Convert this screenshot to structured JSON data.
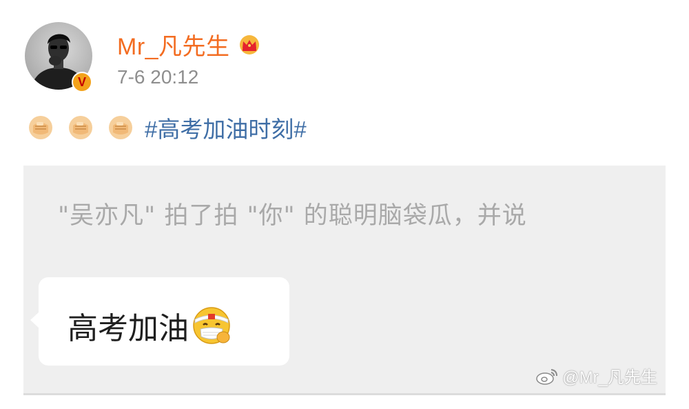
{
  "post": {
    "author": {
      "name": "Mr_凡先生",
      "avatar_icon": "user-avatar-icon",
      "badge_icon": "verified-v-icon",
      "badge_text": "V",
      "member_icon": "crown-icon",
      "name_color": "#f36c21"
    },
    "timestamp": "7-6 20:12",
    "content": {
      "emojis": [
        "fist-bump-emoji",
        "fist-bump-emoji",
        "fist-bump-emoji"
      ],
      "hashtag": "#高考加油时刻#",
      "hashtag_color": "#3f6ea6"
    }
  },
  "embedded_image": {
    "pat_message": "\"吴亦凡\" 拍了拍 \"你\" 的聪明脑袋瓜，并说",
    "chat_bubble": {
      "text": "高考加油",
      "emoji": "mask-headband-face-emoji"
    },
    "watermark": {
      "icon": "weibo-logo-icon",
      "text": "@Mr_凡先生"
    }
  }
}
